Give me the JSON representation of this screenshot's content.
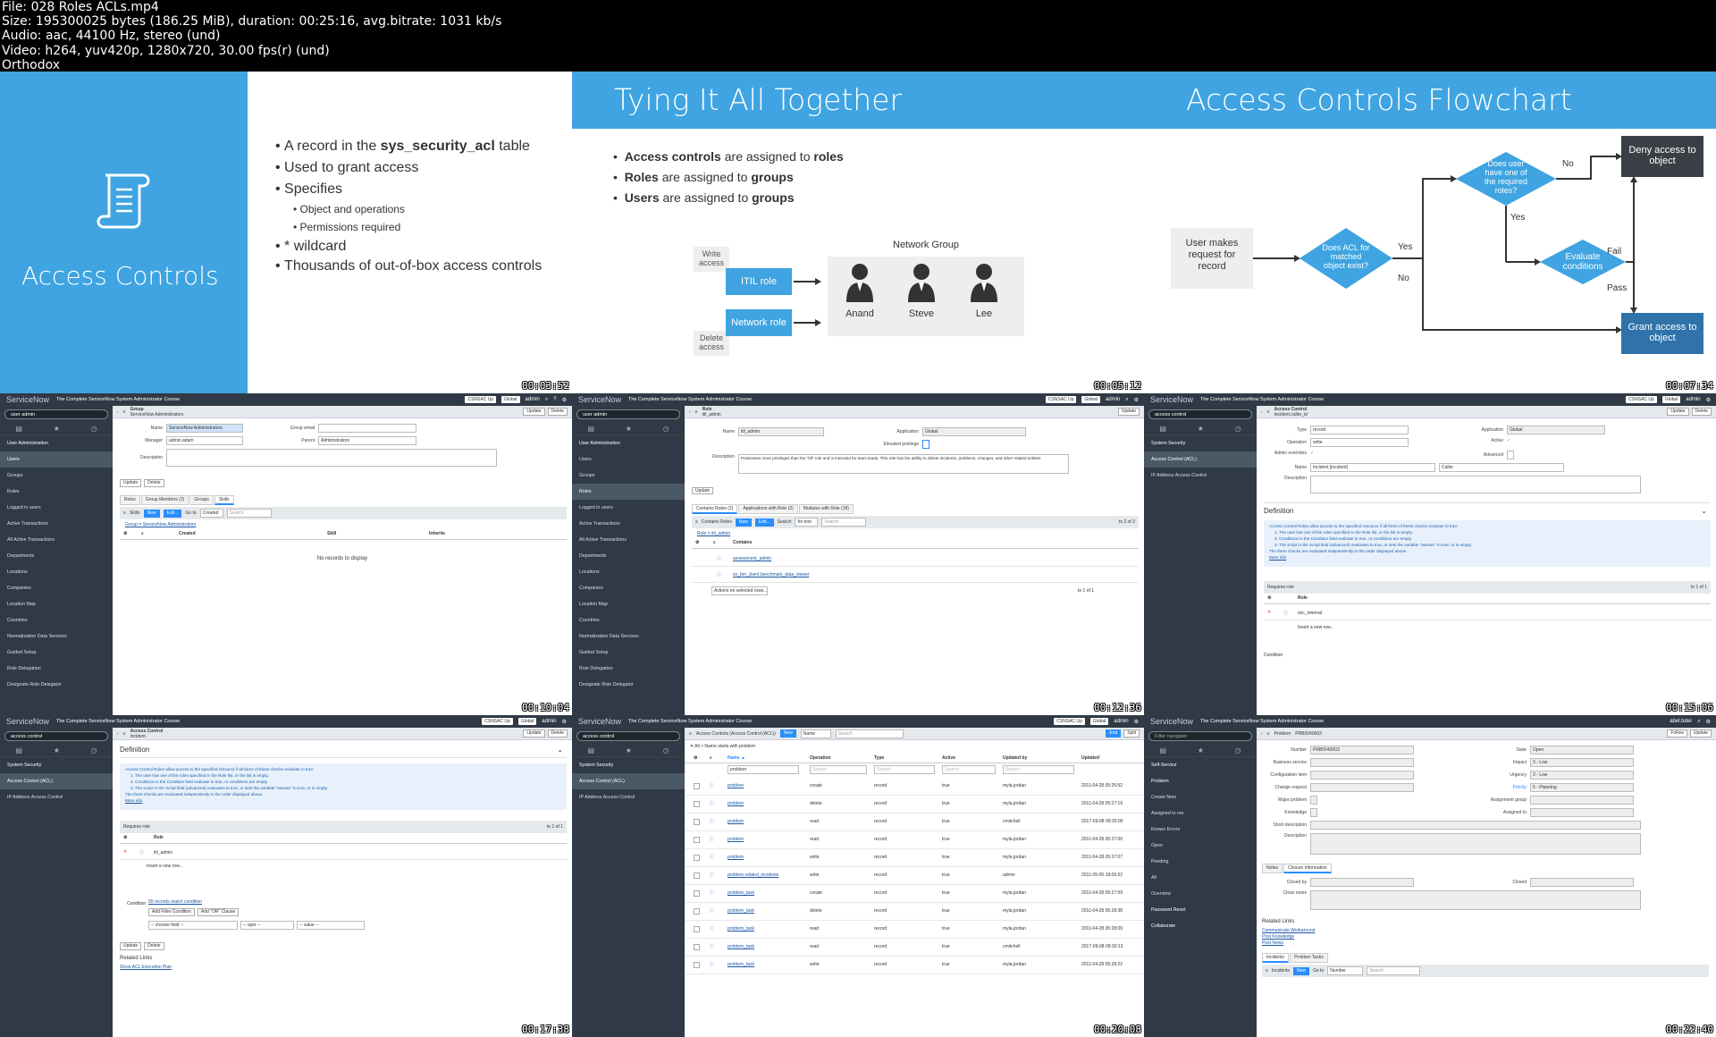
{
  "file_info": {
    "line1": "File: 028 Roles  ACLs.mp4",
    "line2": "Size: 195300025 bytes (186.25 MiB), duration: 00:25:16, avg.bitrate: 1031 kb/s",
    "line3": "Audio: aac, 44100 Hz, stereo (und)",
    "line4": "Video: h264, yuv420p, 1280x720, 30.00 fps(r) (und)",
    "line5": "Orthodox"
  },
  "timestamps": [
    "00:03:52",
    "00:05:12",
    "00:07:34",
    "00:10:04",
    "00:12:36",
    "00:15:06",
    "00:17:38",
    "00:20:08",
    "00:22:40"
  ],
  "slide1": {
    "title": "Access Controls",
    "bullets": [
      {
        "pre": "A record in the ",
        "bold": "sys_security_acl",
        "post": " table"
      },
      {
        "pre": "Used to grant access",
        "bold": "",
        "post": ""
      },
      {
        "pre": "Specifies",
        "bold": "",
        "post": ""
      },
      {
        "pre": "* wildcard",
        "bold": "",
        "post": ""
      },
      {
        "pre": "Thousands of out-of-box access controls",
        "bold": "",
        "post": ""
      }
    ],
    "sub_bullets": [
      "Object and operations",
      "Permissions required"
    ]
  },
  "slide2": {
    "title": "Tying It All Together",
    "bullets": [
      {
        "b1": "Access controls",
        "mid": " are assigned to ",
        "b2": "roles"
      },
      {
        "b1": "Roles",
        "mid": " are assigned to ",
        "b2": "groups"
      },
      {
        "b1": "Users",
        "mid": " are assigned to ",
        "b2": "groups"
      }
    ],
    "write_access": "Write access",
    "delete_access": "Delete access",
    "itil_role": "ITIL role",
    "network_role": "Network role",
    "network_group": "Network Group",
    "people": [
      "Anand",
      "Steve",
      "Lee"
    ]
  },
  "slide3": {
    "title": "Access Controls Flowchart",
    "start": "User makes request for record",
    "d1": "Does ACL for matched object exist?",
    "d2": "Does user have one of the required roles?",
    "d3": "Evaluate conditions",
    "deny": "Deny access to object",
    "grant": "Grant access to object",
    "yes": "Yes",
    "no": "No",
    "fail": "Fail",
    "pass": "Pass"
  },
  "sn_common": {
    "brand": "ServiceNow",
    "course": "The Complete ServiceNow System Administrator Course",
    "scope": "CSNSAC Up",
    "domain": "Global",
    "user": "admin",
    "update": "Update",
    "delete": "Delete"
  },
  "tile4": {
    "filter": "user admin",
    "nav": [
      "User Administration",
      "Users",
      "Groups",
      "Roles",
      "Logged in users",
      "Active Transactions",
      "All Active Transactions",
      "Departments",
      "Locations",
      "Companies",
      "Location Map",
      "Countries",
      "Normalization Data Services",
      "Guided Setup",
      "Role Delegation",
      "Designate Role Delegator"
    ],
    "form_kind": "Group",
    "form_name": "ServiceNow Administrators",
    "labels": {
      "name": "Name",
      "manager": "Manager",
      "description": "Description",
      "group_email": "Group email",
      "parent": "Parent"
    },
    "values": {
      "name": "ServiceNow Administrators",
      "manager": "admin.adam",
      "parent": "Administrators"
    },
    "tabs": [
      "Roles",
      "Group Members (2)",
      "Groups",
      "Skills"
    ],
    "list_title": "Skills",
    "new": "New",
    "edit": "Edit...",
    "goto": "Go to",
    "goto_field": "Created",
    "search": "Search",
    "breadcrumb": "Group = ServiceNow Administrators",
    "cols": [
      "Created",
      "Skill",
      "Inherits"
    ],
    "empty": "No records to display"
  },
  "tile5": {
    "filter": "user admin",
    "form_kind": "Role",
    "form_name": "itil_admin",
    "labels": {
      "name": "Name",
      "application": "Application",
      "elevated": "Elevated privilege",
      "description": "Description"
    },
    "values": {
      "name": "itil_admin",
      "application": "Global",
      "description": "Possesses more privileges than the \"itil\" role and is intended for team leads. This role has the ability to delete incidents, problems, changes, and other related entities"
    },
    "tabs": [
      "Contains Roles (2)",
      "Applications with Role (2)",
      "Modules with Role (18)"
    ],
    "list_title": "Contains Roles",
    "search_label": "Search",
    "search_field": "for text",
    "breadcrumb": "Role = itil_admin",
    "col": "Contains",
    "rows": [
      "assessment_admin",
      "sn_bm_client.benchmark_data_viewer"
    ],
    "actions": "Actions on selected rows...",
    "pager": "to 2 of 2",
    "pager2": "to 1 of 1",
    "page1": "1"
  },
  "tile6": {
    "filter": "access control",
    "nav": [
      "System Security",
      "Access Control (ACL)",
      "IP Address Access Control"
    ],
    "form_kind": "Access Control",
    "form_name": "incident.caller_id",
    "labels": {
      "type": "Type",
      "operation": "Operation",
      "admin_overrides": "Admin overrides",
      "name": "Name",
      "description": "Description",
      "application": "Application",
      "active": "Active",
      "advanced": "Advanced"
    },
    "values": {
      "type": "record",
      "operation": "write",
      "name": "Incident [incident]",
      "field": "Caller",
      "application": "Global"
    },
    "definition": "Definition",
    "def_text": [
      "Access Control Rules allow access to the specified resource if all three of these checks evaluate to true:",
      "1. The user has one of the roles specified in the Role list, or the list is empty.",
      "2. Conditions in the Condition field evaluate to true, or conditions are empty.",
      "3. The script in the Script field (advanced) evaluates to true, or sets the variable \"answer\" to true, or is empty.",
      "The three checks are evaluated independently in the order displayed above.",
      "More info"
    ],
    "requires_role": "Requires role",
    "role_col": "Role",
    "role": "snc_internal",
    "insert": "Insert a new row...",
    "pager": "to 1 of 1",
    "condition": "Condition"
  },
  "tile7": {
    "filter": "access control",
    "form_kind": "Access Control",
    "form_name": "incident",
    "definition": "Definition",
    "requires_role": "Requires role",
    "role_col": "Role",
    "role": "itil_admin",
    "insert": "Insert a new row...",
    "pager": "to 1 of 1",
    "condition": "Condition",
    "cond_link": "55 records match condition",
    "add_filter": "Add Filter Condition",
    "add_or": "Add \"OR\" Clause",
    "choose": "-- choose field --",
    "oper": "-- oper --",
    "value": "-- value --",
    "related": "Related Links",
    "show_acl": "Show ACL Execution Plan"
  },
  "tile8": {
    "filter": "access control",
    "list_title": "Access Controls (Access Control (ACL))",
    "new": "New",
    "search_field": "Name",
    "search": "Search",
    "end": "End",
    "split": "Split",
    "breadcrumb": "All > Name starts with problem",
    "cols": [
      "Name ▲",
      "Operation",
      "Type",
      "Active",
      "Updated by",
      "Updated"
    ],
    "search_val": "problem",
    "rows": [
      [
        "problem",
        "create",
        "record",
        "true",
        "myla.jordan",
        "2011-04-28 05:26:52"
      ],
      [
        "problem",
        "delete",
        "record",
        "true",
        "myla.jordan",
        "2011-04-28 05:27:19"
      ],
      [
        "problem",
        "read",
        "record",
        "true",
        "cmitchell",
        "2017-09-08 09:30:00"
      ],
      [
        "problem",
        "read",
        "record",
        "true",
        "myla.jordan",
        "2011-04-28 05:27:00"
      ],
      [
        "problem",
        "write",
        "record",
        "true",
        "myla.jordan",
        "2011-04-28 05:27:07"
      ],
      [
        "problem.related_incidents",
        "write",
        "record",
        "true",
        "admin",
        "2011-05-05 18:06:52"
      ],
      [
        "problem_task",
        "create",
        "record",
        "true",
        "myla.jordan",
        "2011-04-28 05:27:59"
      ],
      [
        "problem_task",
        "delete",
        "record",
        "true",
        "myla.jordan",
        "2011-04-28 05:28:38"
      ],
      [
        "problem_task",
        "read",
        "record",
        "true",
        "myla.jordan",
        "2011-04-28 05:28:09"
      ],
      [
        "problem_task",
        "read",
        "record",
        "true",
        "cmitchell",
        "2017-09-08 09:30:13"
      ],
      [
        "problem_task",
        "write",
        "record",
        "true",
        "myla.jordan",
        "2011-04-28 05:28:22"
      ]
    ],
    "footer": "20 rows per page"
  },
  "tile9": {
    "filter": "Filter navigator",
    "user": "abel.tuter",
    "nav": [
      "Self-Service",
      "Problem",
      "Create New",
      "Assigned to me",
      "Known Errors",
      "Open",
      "Pending",
      "All",
      "Overview",
      "Password Reset",
      "Collaborate"
    ],
    "form_kind": "Problem",
    "form_name": "PRB0040003",
    "follow": "Follow",
    "left_labels": [
      "Number",
      "Business service",
      "Configuration item",
      "Change request",
      "Major problem",
      "Knowledge",
      "Short description",
      "Description"
    ],
    "right_labels": [
      "State",
      "Impact",
      "Urgency",
      "Priority",
      "Assignment group",
      "Assigned to"
    ],
    "number": "PRB0040003",
    "state": "Open",
    "impact": "3 - Low",
    "urgency": "3 - Low",
    "priority": "5 - Planning",
    "tabs": [
      "Notes",
      "Closure Information"
    ],
    "closed_by": "Closed by",
    "closed": "Closed",
    "close_notes": "Close notes",
    "related": "Related Links",
    "links": [
      "Communicate Workaround",
      "Post Knowledge",
      "Post News"
    ],
    "list_tabs": [
      "Incidents",
      "Problem Tasks"
    ],
    "list_title": "Incidents",
    "new": "New",
    "goto": "Go to",
    "goto_field": "Number",
    "search": "Search"
  }
}
